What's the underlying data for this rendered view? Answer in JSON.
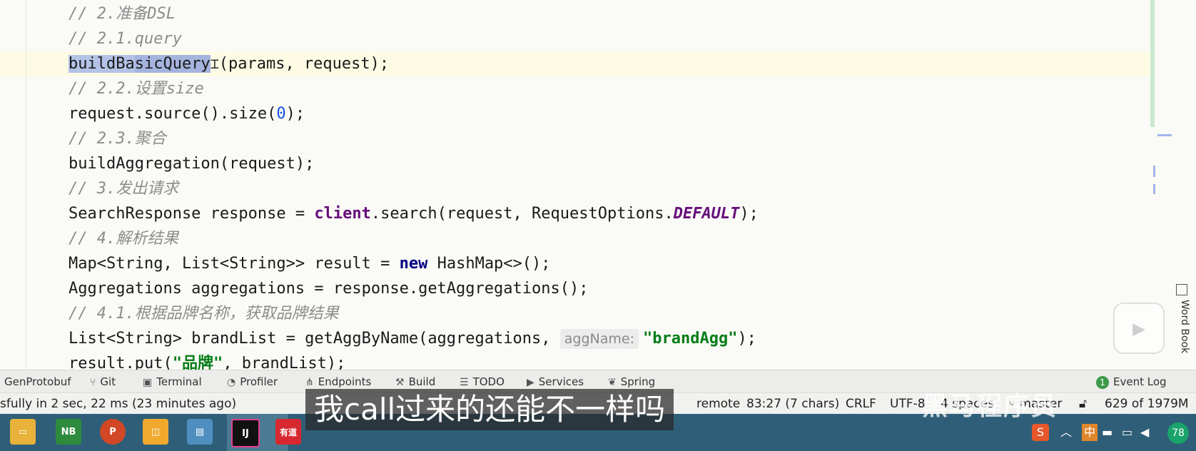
{
  "editor": {
    "lines": {
      "l1": "// 2.准备DSL",
      "l2": "// 2.1.query",
      "l3_sel1": "buildBa",
      "l3_sel2": "sicQuery",
      "l3_rest": "(params, request);",
      "l4": "// 2.2.设置size",
      "l5_a": "request.source().size(",
      "l5_num": "0",
      "l5_b": ");",
      "l6": "// 2.3.聚合",
      "l7": "buildAggregation(request);",
      "l8": "// 3.发出请求",
      "l9_a": "SearchResponse response = ",
      "l9_field": "client",
      "l9_b": ".search(request, RequestOptions.",
      "l9_const": "DEFAULT",
      "l9_c": ");",
      "l10": "// 4.解析结果",
      "l11_a": "Map<String, List<String>> result = ",
      "l11_kw": "new",
      "l11_b": " HashMap<>();",
      "l12": "Aggregations aggregations = response.getAggregations();",
      "l13": "// 4.1.根据品牌名称，获取品牌结果",
      "l14_a": "List<String> brandList = getAggByName(aggregations, ",
      "l14_hint": "aggName:",
      "l14_str": "\"brandAgg\"",
      "l14_b": ");",
      "l15_a": "result.put(",
      "l15_str": "\"品牌\"",
      "l15_b": ", brandList);"
    },
    "word_book_label": "Word Book"
  },
  "toolwindows": {
    "genprotobuf": "GenProtobuf",
    "git": "Git",
    "terminal": "Terminal",
    "profiler": "Profiler",
    "endpoints": "Endpoints",
    "build": "Build",
    "todo": "TODO",
    "services": "Services",
    "spring": "Spring",
    "event_log_count": "1",
    "event_log": "Event Log"
  },
  "status": {
    "message": "sfully in 2 sec, 22 ms (23 minutes ago)",
    "remote": "remote",
    "position": "83:27 (7 chars)",
    "line_sep": "CRLF",
    "encoding": "UTF-8",
    "indent": "4 spaces",
    "branch": "master",
    "memory": "629 of 1979M"
  },
  "subtitle": "我call过来的还能不一样吗",
  "watermark": "黑马程序员",
  "taskbar": {
    "apps": [
      "NB",
      "P",
      "IJ",
      "有道"
    ],
    "tray_ime": "中",
    "badge": "78"
  }
}
